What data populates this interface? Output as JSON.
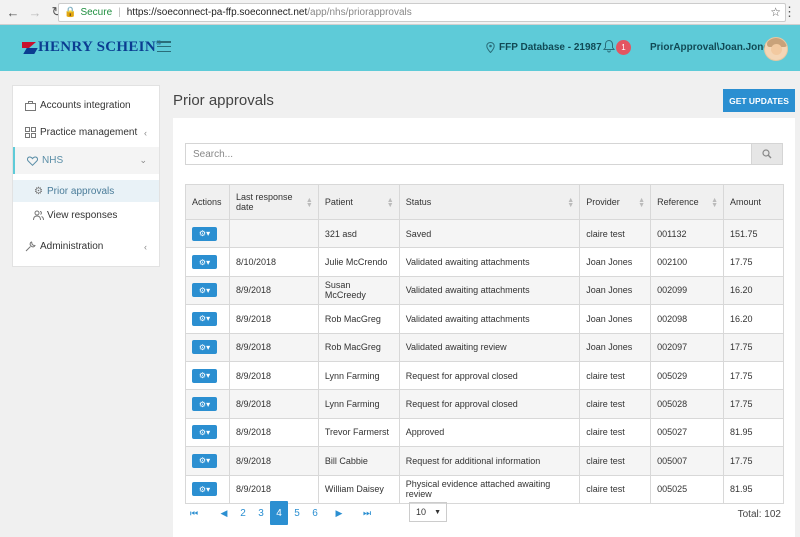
{
  "browser": {
    "secure_label": "Secure",
    "url_host": "https://soeconnect-pa-ffp.soeconnect.net",
    "url_path": "/app/nhs/priorapprovals"
  },
  "header": {
    "brand": "HENRY SCHEIN",
    "brand_mark": "®",
    "database": "FFP Database - 21987",
    "notification_count": "1",
    "user": "PriorApproval\\Joan.Jones"
  },
  "sidebar": {
    "items": [
      {
        "label": "Accounts integration"
      },
      {
        "label": "Practice management"
      },
      {
        "label": "NHS"
      },
      {
        "label": "Prior approvals"
      },
      {
        "label": "View responses"
      },
      {
        "label": "Administration"
      }
    ]
  },
  "page": {
    "title": "Prior approvals",
    "get_updates": "GET UPDATES",
    "search_placeholder": "Search..."
  },
  "table": {
    "columns": [
      "Actions",
      "Last response date",
      "Patient",
      "Status",
      "Provider",
      "Reference",
      "Amount"
    ],
    "rows": [
      {
        "date": "",
        "patient": "321 asd",
        "status": "Saved",
        "provider": "claire test",
        "reference": "001132",
        "amount": "151.75"
      },
      {
        "date": "8/10/2018",
        "patient": "Julie McCrendo",
        "status": "Validated awaiting attachments",
        "provider": "Joan Jones",
        "reference": "002100",
        "amount": "17.75"
      },
      {
        "date": "8/9/2018",
        "patient": "Susan McCreedy",
        "status": "Validated awaiting attachments",
        "provider": "Joan Jones",
        "reference": "002099",
        "amount": "16.20"
      },
      {
        "date": "8/9/2018",
        "patient": "Rob MacGreg",
        "status": "Validated awaiting attachments",
        "provider": "Joan Jones",
        "reference": "002098",
        "amount": "16.20"
      },
      {
        "date": "8/9/2018",
        "patient": "Rob MacGreg",
        "status": "Validated awaiting review",
        "provider": "Joan Jones",
        "reference": "002097",
        "amount": "17.75"
      },
      {
        "date": "8/9/2018",
        "patient": "Lynn Farming",
        "status": "Request for approval closed",
        "provider": "claire test",
        "reference": "005029",
        "amount": "17.75"
      },
      {
        "date": "8/9/2018",
        "patient": "Lynn Farming",
        "status": "Request for approval closed",
        "provider": "claire test",
        "reference": "005028",
        "amount": "17.75"
      },
      {
        "date": "8/9/2018",
        "patient": "Trevor Farmerst",
        "status": "Approved",
        "provider": "claire test",
        "reference": "005027",
        "amount": "81.95"
      },
      {
        "date": "8/9/2018",
        "patient": "Bill Cabbie",
        "status": "Request for additional information",
        "provider": "claire test",
        "reference": "005007",
        "amount": "17.75"
      },
      {
        "date": "8/9/2018",
        "patient": "William Daisey",
        "status": "Physical evidence attached awaiting review",
        "provider": "claire test",
        "reference": "005025",
        "amount": "81.95"
      }
    ]
  },
  "pagination": {
    "pages": [
      "2",
      "3",
      "4",
      "5",
      "6"
    ],
    "current": "4",
    "page_size": "10",
    "total": "Total: 102"
  }
}
